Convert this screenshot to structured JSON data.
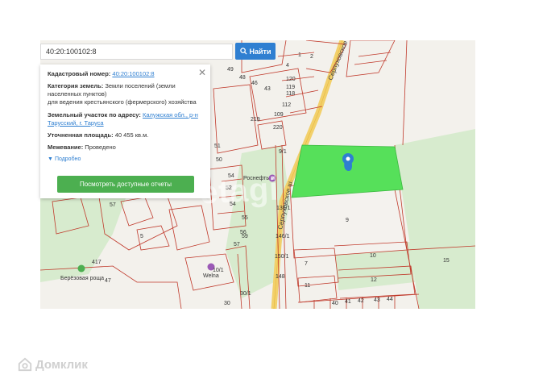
{
  "search": {
    "value": "40:20:100102:8",
    "button_label": "Найти"
  },
  "info_panel": {
    "cadastral_label": "Кадастровый номер:",
    "cadastral_value": "40:20:100102:8",
    "category_label": "Категория земель:",
    "category_value": "Земли поселений (земли населенных пунктов)",
    "category_use": "для ведения крестьянского (фермерского) хозяйства",
    "address_label": "Земельный участок по адресу:",
    "address_value": "Калужская обл., р-н Тарусский, г. Таруса",
    "area_label": "Уточненная площадь:",
    "area_value": "40 455 кв.м.",
    "survey_label": "Межевание:",
    "survey_value": "Проведено",
    "details_label": "Подробно",
    "reports_button": "Посмотреть доступные отчеты"
  },
  "map": {
    "road_name_upper": "Серпуховское ш.",
    "road_name_lower": "Серпуховское ш.",
    "poi_rosneft": "Роснефть",
    "poi_welna": "Welna",
    "poi_birch_grove": "Берёзовая роща",
    "parcel_labels": [
      "49",
      "48",
      "46",
      "43",
      "4",
      "120",
      "119",
      "118",
      "112",
      "109",
      "1",
      "2",
      "219",
      "220",
      "54",
      "52",
      "51",
      "50",
      "57",
      "54",
      "55",
      "56",
      "57",
      "59",
      "5",
      "47",
      "417",
      "10/1",
      "30/1",
      "30",
      "9",
      "7",
      "10",
      "11",
      "12",
      "15",
      "40",
      "41",
      "42",
      "43",
      "44",
      "9/1",
      "136/1",
      "146/1",
      "150/1",
      "148"
    ],
    "colors": {
      "highlight": "#56e05a",
      "boundary": "#c0392b",
      "green_zone": "#d7ebce",
      "road": "#f2d06b"
    }
  },
  "watermark": "etagi",
  "brand": "Домклик"
}
